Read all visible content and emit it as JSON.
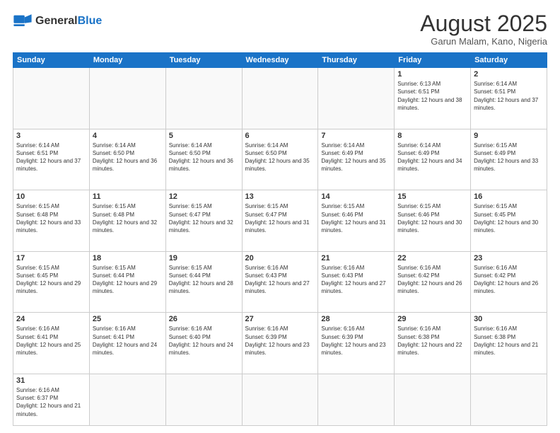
{
  "logo": {
    "text_general": "General",
    "text_blue": "Blue"
  },
  "header": {
    "month_title": "August 2025",
    "subtitle": "Garun Malam, Kano, Nigeria"
  },
  "days_of_week": [
    "Sunday",
    "Monday",
    "Tuesday",
    "Wednesday",
    "Thursday",
    "Friday",
    "Saturday"
  ],
  "weeks": [
    [
      {
        "day": "",
        "empty": true
      },
      {
        "day": "",
        "empty": true
      },
      {
        "day": "",
        "empty": true
      },
      {
        "day": "",
        "empty": true
      },
      {
        "day": "",
        "empty": true
      },
      {
        "day": "1",
        "sunrise": "6:13 AM",
        "sunset": "6:51 PM",
        "daylight": "12 hours and 38 minutes."
      },
      {
        "day": "2",
        "sunrise": "6:14 AM",
        "sunset": "6:51 PM",
        "daylight": "12 hours and 37 minutes."
      }
    ],
    [
      {
        "day": "3",
        "sunrise": "6:14 AM",
        "sunset": "6:51 PM",
        "daylight": "12 hours and 37 minutes."
      },
      {
        "day": "4",
        "sunrise": "6:14 AM",
        "sunset": "6:50 PM",
        "daylight": "12 hours and 36 minutes."
      },
      {
        "day": "5",
        "sunrise": "6:14 AM",
        "sunset": "6:50 PM",
        "daylight": "12 hours and 36 minutes."
      },
      {
        "day": "6",
        "sunrise": "6:14 AM",
        "sunset": "6:50 PM",
        "daylight": "12 hours and 35 minutes."
      },
      {
        "day": "7",
        "sunrise": "6:14 AM",
        "sunset": "6:49 PM",
        "daylight": "12 hours and 35 minutes."
      },
      {
        "day": "8",
        "sunrise": "6:14 AM",
        "sunset": "6:49 PM",
        "daylight": "12 hours and 34 minutes."
      },
      {
        "day": "9",
        "sunrise": "6:15 AM",
        "sunset": "6:49 PM",
        "daylight": "12 hours and 33 minutes."
      }
    ],
    [
      {
        "day": "10",
        "sunrise": "6:15 AM",
        "sunset": "6:48 PM",
        "daylight": "12 hours and 33 minutes."
      },
      {
        "day": "11",
        "sunrise": "6:15 AM",
        "sunset": "6:48 PM",
        "daylight": "12 hours and 32 minutes."
      },
      {
        "day": "12",
        "sunrise": "6:15 AM",
        "sunset": "6:47 PM",
        "daylight": "12 hours and 32 minutes."
      },
      {
        "day": "13",
        "sunrise": "6:15 AM",
        "sunset": "6:47 PM",
        "daylight": "12 hours and 31 minutes."
      },
      {
        "day": "14",
        "sunrise": "6:15 AM",
        "sunset": "6:46 PM",
        "daylight": "12 hours and 31 minutes."
      },
      {
        "day": "15",
        "sunrise": "6:15 AM",
        "sunset": "6:46 PM",
        "daylight": "12 hours and 30 minutes."
      },
      {
        "day": "16",
        "sunrise": "6:15 AM",
        "sunset": "6:45 PM",
        "daylight": "12 hours and 30 minutes."
      }
    ],
    [
      {
        "day": "17",
        "sunrise": "6:15 AM",
        "sunset": "6:45 PM",
        "daylight": "12 hours and 29 minutes."
      },
      {
        "day": "18",
        "sunrise": "6:15 AM",
        "sunset": "6:44 PM",
        "daylight": "12 hours and 29 minutes."
      },
      {
        "day": "19",
        "sunrise": "6:15 AM",
        "sunset": "6:44 PM",
        "daylight": "12 hours and 28 minutes."
      },
      {
        "day": "20",
        "sunrise": "6:16 AM",
        "sunset": "6:43 PM",
        "daylight": "12 hours and 27 minutes."
      },
      {
        "day": "21",
        "sunrise": "6:16 AM",
        "sunset": "6:43 PM",
        "daylight": "12 hours and 27 minutes."
      },
      {
        "day": "22",
        "sunrise": "6:16 AM",
        "sunset": "6:42 PM",
        "daylight": "12 hours and 26 minutes."
      },
      {
        "day": "23",
        "sunrise": "6:16 AM",
        "sunset": "6:42 PM",
        "daylight": "12 hours and 26 minutes."
      }
    ],
    [
      {
        "day": "24",
        "sunrise": "6:16 AM",
        "sunset": "6:41 PM",
        "daylight": "12 hours and 25 minutes."
      },
      {
        "day": "25",
        "sunrise": "6:16 AM",
        "sunset": "6:41 PM",
        "daylight": "12 hours and 24 minutes."
      },
      {
        "day": "26",
        "sunrise": "6:16 AM",
        "sunset": "6:40 PM",
        "daylight": "12 hours and 24 minutes."
      },
      {
        "day": "27",
        "sunrise": "6:16 AM",
        "sunset": "6:39 PM",
        "daylight": "12 hours and 23 minutes."
      },
      {
        "day": "28",
        "sunrise": "6:16 AM",
        "sunset": "6:39 PM",
        "daylight": "12 hours and 23 minutes."
      },
      {
        "day": "29",
        "sunrise": "6:16 AM",
        "sunset": "6:38 PM",
        "daylight": "12 hours and 22 minutes."
      },
      {
        "day": "30",
        "sunrise": "6:16 AM",
        "sunset": "6:38 PM",
        "daylight": "12 hours and 21 minutes."
      }
    ],
    [
      {
        "day": "31",
        "sunrise": "6:16 AM",
        "sunset": "6:37 PM",
        "daylight": "12 hours and 21 minutes."
      },
      {
        "day": "",
        "empty": true
      },
      {
        "day": "",
        "empty": true
      },
      {
        "day": "",
        "empty": true
      },
      {
        "day": "",
        "empty": true
      },
      {
        "day": "",
        "empty": true
      },
      {
        "day": "",
        "empty": true
      }
    ]
  ]
}
